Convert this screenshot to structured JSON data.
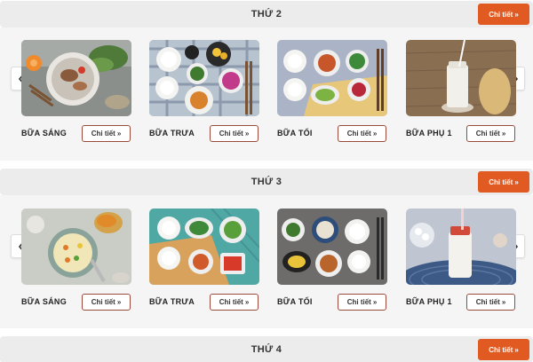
{
  "days": [
    {
      "title": "THỨ 2",
      "detail_label": "Chi tiết",
      "meals": [
        {
          "label": "BỮA SÁNG",
          "detail_label": "Chi tiết"
        },
        {
          "label": "BỮA TRƯA",
          "detail_label": "Chi tiết"
        },
        {
          "label": "BỮA TỐI",
          "detail_label": "Chi tiết"
        },
        {
          "label": "BỮA PHỤ 1",
          "detail_label": "Chi tiết"
        }
      ]
    },
    {
      "title": "THỨ 3",
      "detail_label": "Chi tiết",
      "meals": [
        {
          "label": "BỮA SÁNG",
          "detail_label": "Chi tiết"
        },
        {
          "label": "BỮA TRƯA",
          "detail_label": "Chi tiết"
        },
        {
          "label": "BỮA TỐI",
          "detail_label": "Chi tiết"
        },
        {
          "label": "BỮA PHỤ 1",
          "detail_label": "Chi tiết"
        }
      ]
    },
    {
      "title": "THỨ 4",
      "detail_label": "Chi tiết"
    }
  ],
  "icons": {
    "prev": "chevron-left-icon",
    "next": "chevron-right-icon",
    "double_chevron": "double-chevron-right-icon"
  },
  "colors": {
    "accent": "#e05a22",
    "header_bg": "#ececec",
    "body_bg": "#f5f5f5",
    "small_button_border": "#9a4a3a"
  }
}
